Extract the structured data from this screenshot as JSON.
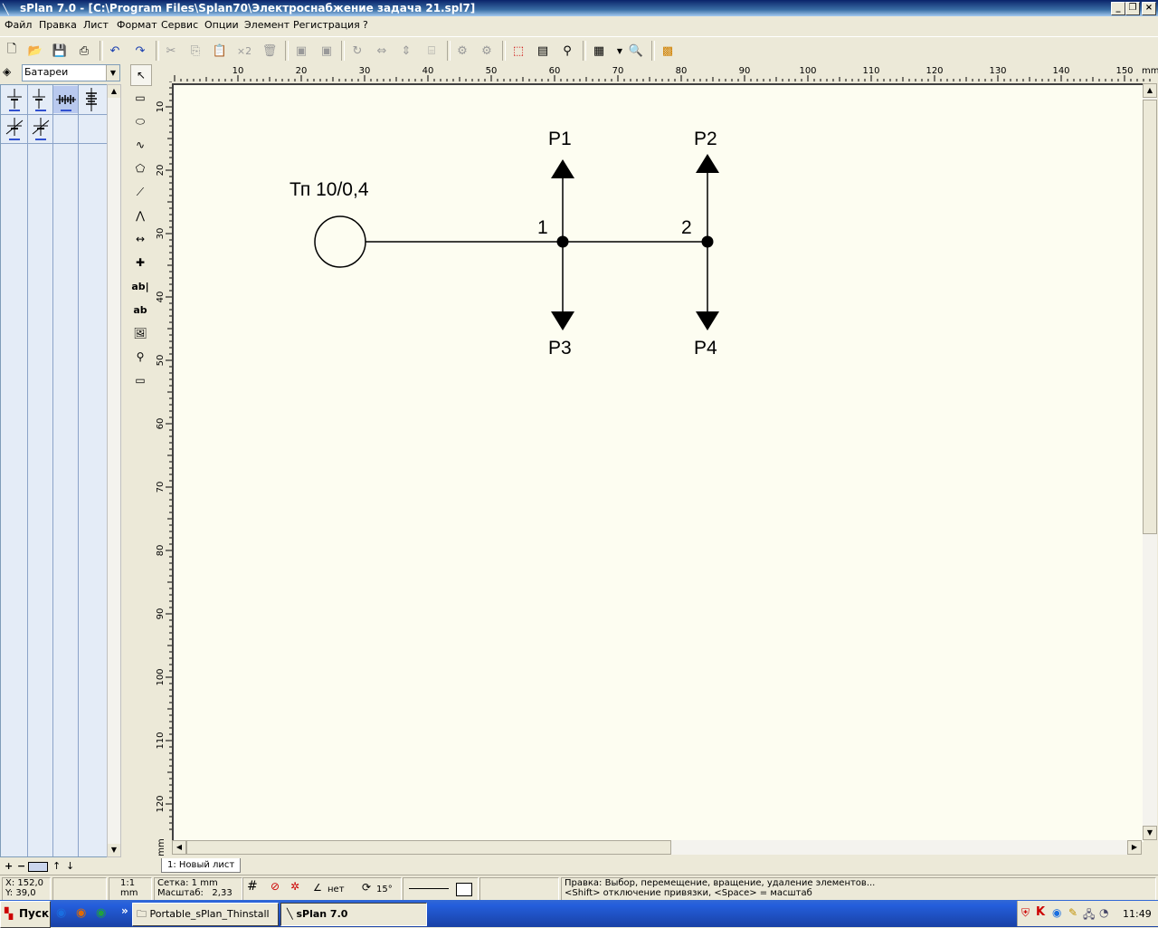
{
  "window": {
    "title": "sPlan 7.0 - [C:\\Program Files\\Splan70\\Электроснабжение задача 21.spl7]"
  },
  "menu": [
    "Файл",
    "Правка",
    "Лист",
    "Формат",
    "Сервис",
    "Опции",
    "Элемент",
    "Регистрация",
    "?"
  ],
  "library": {
    "selected": "Батареи"
  },
  "rulers": {
    "top_ticks": [
      "10",
      "20",
      "30",
      "40",
      "50",
      "60",
      "70",
      "80",
      "90",
      "100",
      "110",
      "120",
      "130",
      "140",
      "150"
    ],
    "top_unit": "mm",
    "left_ticks": [
      "10",
      "20",
      "30",
      "40",
      "50",
      "60",
      "70",
      "80",
      "90",
      "100",
      "110",
      "120"
    ],
    "left_unit": "mm"
  },
  "schematic": {
    "source_label": "Тп 10/0,4",
    "node1": "1",
    "node2": "2",
    "p1": "P1",
    "p2": "P2",
    "p3": "P3",
    "p4": "P4"
  },
  "sheet_tab": "1: Новый лист",
  "status": {
    "x": "X: 152,0",
    "y": "Y: 39,0",
    "scale_ratio": "1:1",
    "scale_unit": "mm",
    "grid": "Сетка: 1 mm",
    "zoom": "Масштаб:   2,33",
    "snap": "нет",
    "angle": "15°",
    "hint1": "Правка: Выбор, перемещение, вращение, удаление элементов...",
    "hint2": "<Shift> отключение привязки, <Space> = масштаб"
  },
  "taskbar": {
    "start": "Пуск",
    "task1": "Portable_sPlan_Thinstall",
    "task2": "sPlan 7.0",
    "clock": "11:49",
    "more": "»"
  }
}
